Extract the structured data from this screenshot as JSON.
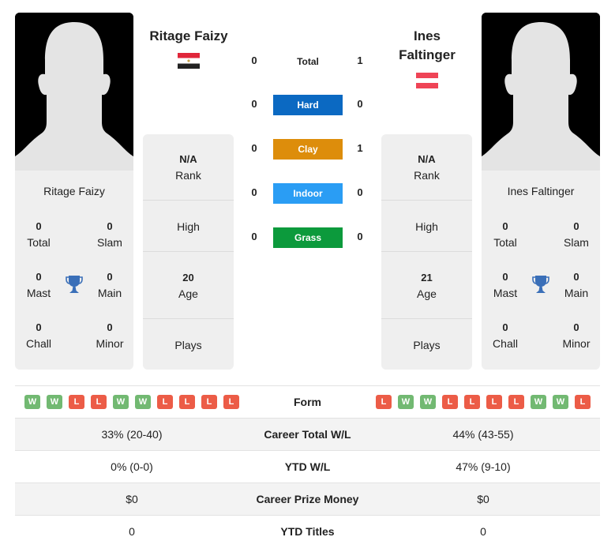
{
  "colors": {
    "hard": "#0b69c2",
    "clay": "#dd8d0b",
    "indoor": "#2a9df4",
    "grass": "#0c9a3c",
    "win": "#72b972",
    "loss": "#ec5c47",
    "trophy": "#3a6fb8"
  },
  "player_left": {
    "name": "Ritage Faizy",
    "header_name": "Ritage Faizy",
    "flag": "egypt-flag",
    "titles": {
      "total": {
        "value": "0",
        "label": "Total"
      },
      "slam": {
        "value": "0",
        "label": "Slam"
      },
      "mast": {
        "value": "0",
        "label": "Mast"
      },
      "main": {
        "value": "0",
        "label": "Main"
      },
      "chall": {
        "value": "0",
        "label": "Chall"
      },
      "minor": {
        "value": "0",
        "label": "Minor"
      }
    },
    "info": {
      "rank_value": "N/A",
      "rank_label": "Rank",
      "high_label": "High",
      "age_value": "20",
      "age_label": "Age",
      "plays_label": "Plays"
    },
    "form": [
      "W",
      "W",
      "L",
      "L",
      "W",
      "W",
      "L",
      "L",
      "L",
      "L"
    ]
  },
  "player_right": {
    "name": "Ines Faltinger",
    "header_name": "Ines Faltinger",
    "flag": "austria-flag",
    "titles": {
      "total": {
        "value": "0",
        "label": "Total"
      },
      "slam": {
        "value": "0",
        "label": "Slam"
      },
      "mast": {
        "value": "0",
        "label": "Mast"
      },
      "main": {
        "value": "0",
        "label": "Main"
      },
      "chall": {
        "value": "0",
        "label": "Chall"
      },
      "minor": {
        "value": "0",
        "label": "Minor"
      }
    },
    "info": {
      "rank_value": "N/A",
      "rank_label": "Rank",
      "high_label": "High",
      "age_value": "21",
      "age_label": "Age",
      "plays_label": "Plays"
    },
    "form": [
      "L",
      "W",
      "W",
      "L",
      "L",
      "L",
      "L",
      "W",
      "W",
      "L"
    ]
  },
  "h2h": {
    "total": {
      "label": "Total",
      "left": "0",
      "right": "1"
    },
    "hard": {
      "label": "Hard",
      "left": "0",
      "right": "0"
    },
    "clay": {
      "label": "Clay",
      "left": "0",
      "right": "1"
    },
    "indoor": {
      "label": "Indoor",
      "left": "0",
      "right": "0"
    },
    "grass": {
      "label": "Grass",
      "left": "0",
      "right": "0"
    }
  },
  "stats": {
    "form_label": "Form",
    "rows": [
      {
        "label": "Career Total W/L",
        "left": "33% (20-40)",
        "right": "44% (43-55)"
      },
      {
        "label": "YTD W/L",
        "left": "0% (0-0)",
        "right": "47% (9-10)"
      },
      {
        "label": "Career Prize Money",
        "left": "$0",
        "right": "$0"
      },
      {
        "label": "YTD Titles",
        "left": "0",
        "right": "0"
      }
    ]
  }
}
